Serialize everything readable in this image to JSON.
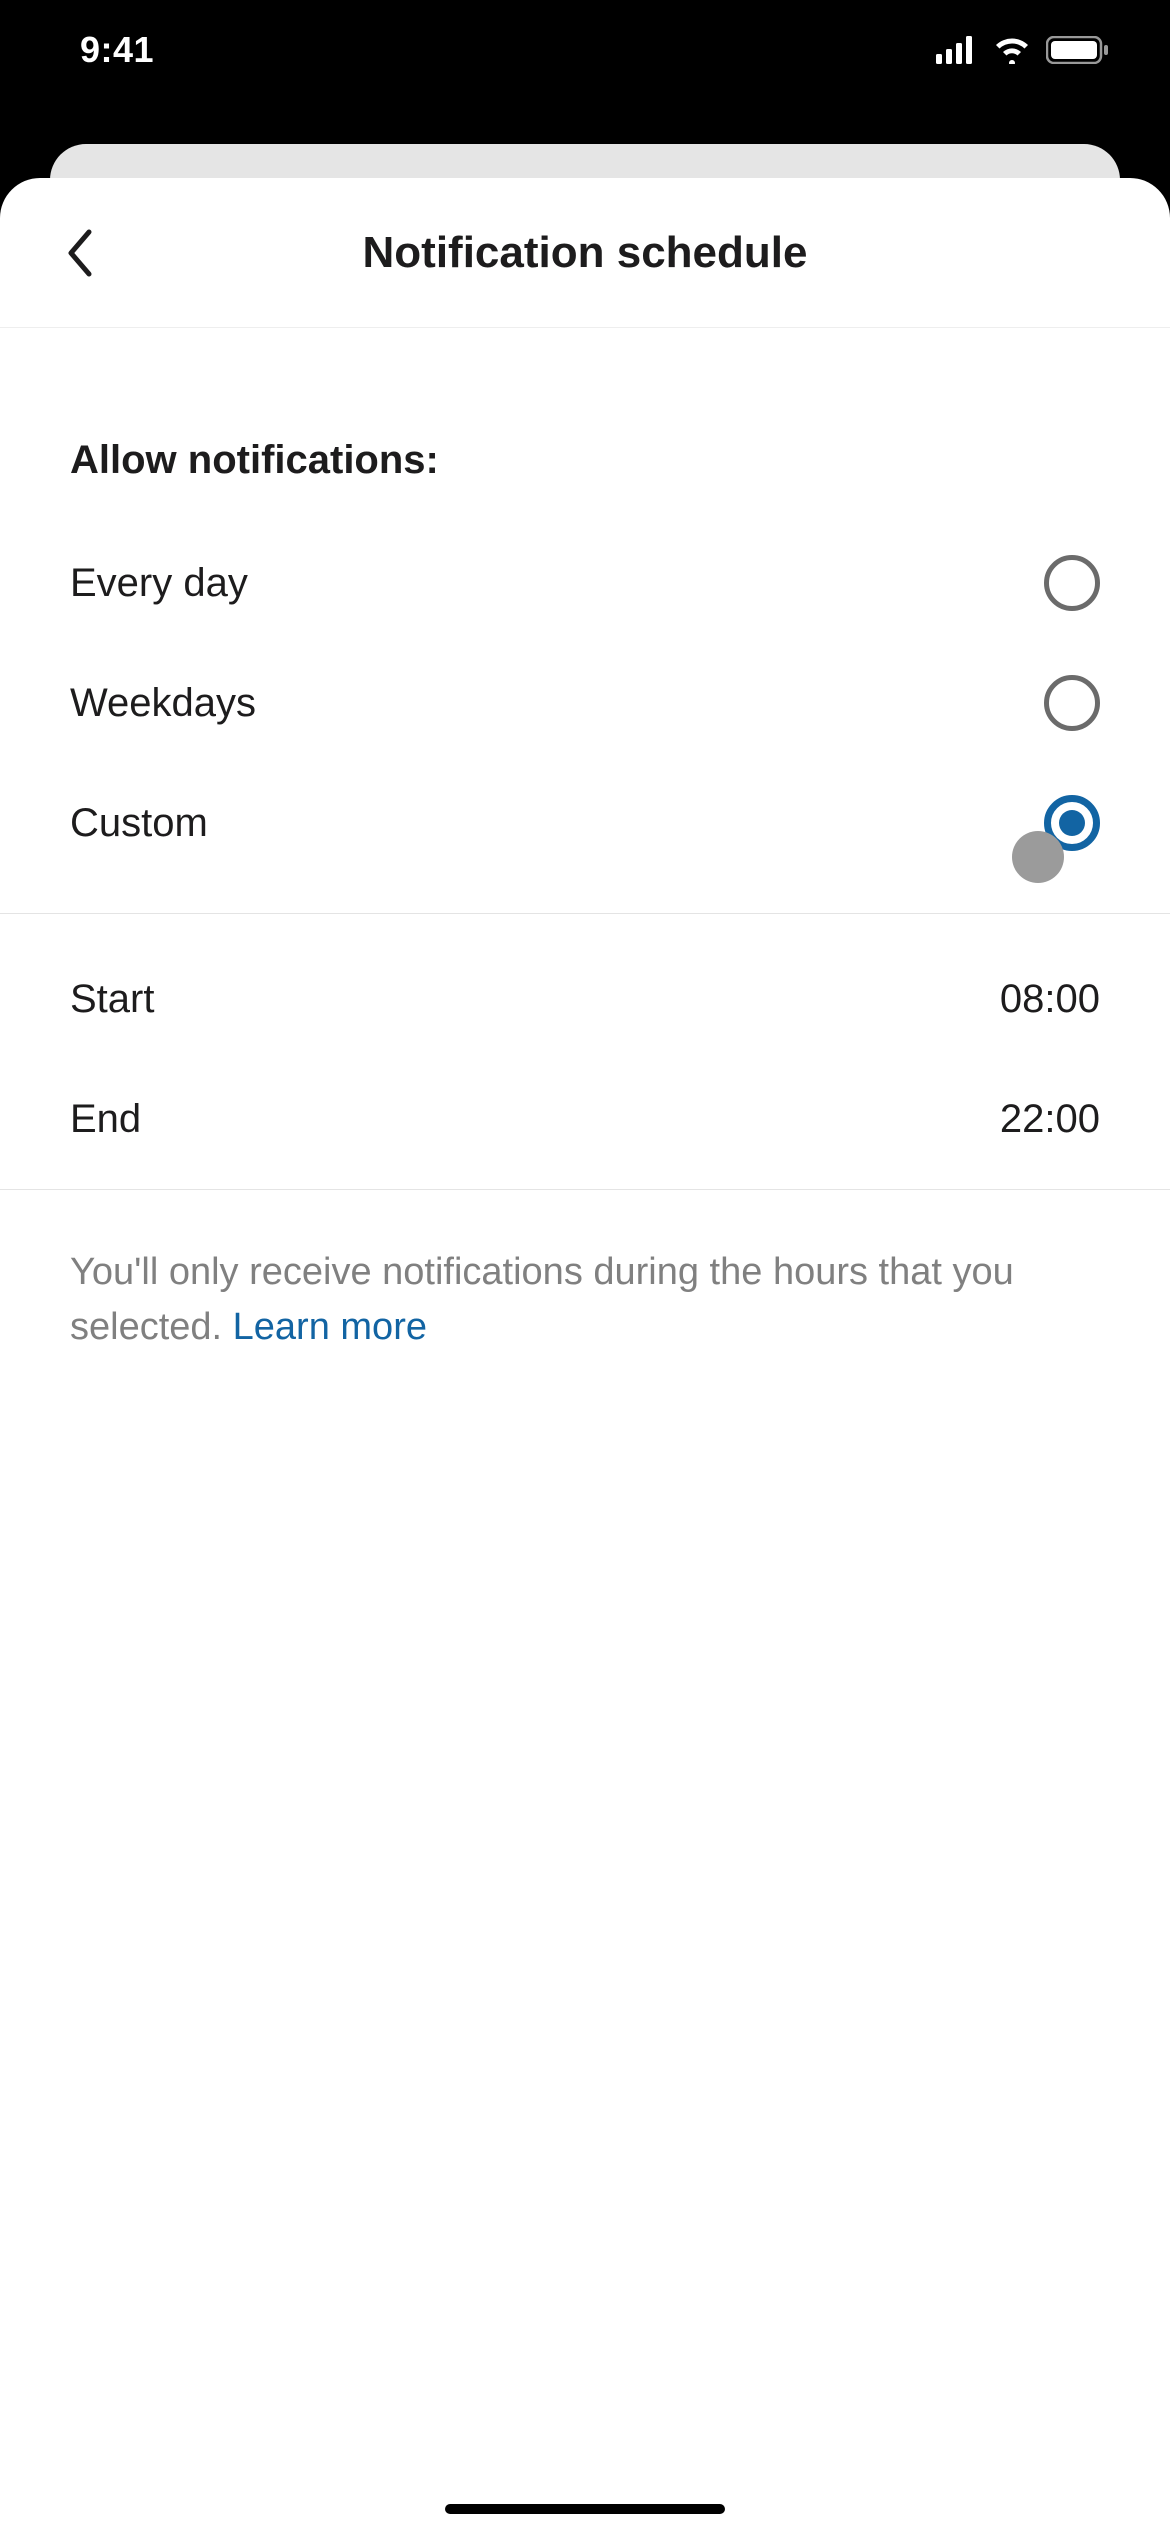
{
  "status": {
    "time": "9:41"
  },
  "header": {
    "title": "Notification schedule"
  },
  "section": {
    "title": "Allow notifications:"
  },
  "options": [
    {
      "label": "Every day",
      "selected": false
    },
    {
      "label": "Weekdays",
      "selected": false
    },
    {
      "label": "Custom",
      "selected": true
    }
  ],
  "times": {
    "start": {
      "label": "Start",
      "value": "08:00"
    },
    "end": {
      "label": "End",
      "value": "22:00"
    }
  },
  "footer": {
    "text": "You'll only receive notifications during the hours that you selected. ",
    "link": "Learn more"
  }
}
